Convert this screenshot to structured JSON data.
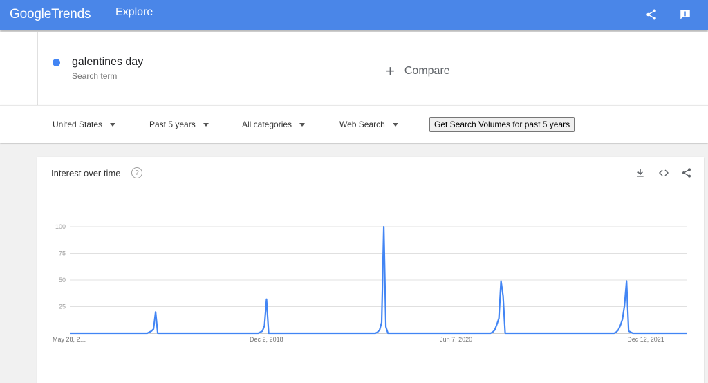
{
  "header": {
    "logo_google": "Google",
    "logo_trends": "Trends",
    "section": "Explore",
    "bg_color": "#4a86e8",
    "icons": [
      "share-icon",
      "feedback-icon"
    ]
  },
  "search": {
    "term": "galentines day",
    "term_type": "Search term",
    "term_color": "#4285f4",
    "compare_label": "Compare"
  },
  "filters": {
    "region": "United States",
    "time_range": "Past 5 years",
    "category": "All categories",
    "search_type": "Web Search",
    "volumes_button": "Get Search Volumes for past 5 years"
  },
  "card": {
    "title": "Interest over time",
    "help_glyph": "?",
    "icons": [
      "download-icon",
      "embed-icon",
      "share-icon"
    ]
  },
  "chart_data": {
    "type": "line",
    "title": "",
    "xlabel": "",
    "ylabel": "",
    "ylim": [
      0,
      100
    ],
    "yticks": [
      25,
      50,
      75,
      100
    ],
    "grid": true,
    "line_color": "#4285f4",
    "x_tick_labels": [
      "May 28, 2…",
      "Dec 2, 2018",
      "Jun 7, 2020",
      "Dec 12, 2021"
    ],
    "series": [
      {
        "values": [
          0,
          0,
          0,
          0,
          0,
          0,
          0,
          0,
          0,
          0,
          0,
          0,
          0,
          0,
          0,
          0,
          0,
          0,
          0,
          0,
          0,
          0,
          0,
          0,
          0,
          0,
          0,
          0,
          0,
          0,
          0,
          0,
          0,
          0,
          0,
          0,
          0,
          0,
          1,
          2,
          4,
          20,
          0,
          0,
          0,
          0,
          0,
          0,
          0,
          0,
          0,
          0,
          0,
          0,
          0,
          0,
          0,
          0,
          0,
          0,
          0,
          0,
          0,
          0,
          0,
          0,
          0,
          0,
          0,
          0,
          0,
          0,
          0,
          0,
          0,
          0,
          0,
          0,
          0,
          0,
          0,
          0,
          0,
          0,
          0,
          0,
          0,
          0,
          0,
          0,
          0,
          1,
          2,
          7,
          32,
          0,
          0,
          0,
          0,
          0,
          0,
          0,
          0,
          0,
          0,
          0,
          0,
          0,
          0,
          0,
          0,
          0,
          0,
          0,
          0,
          0,
          0,
          0,
          0,
          0,
          0,
          0,
          0,
          0,
          0,
          0,
          0,
          0,
          0,
          0,
          0,
          0,
          0,
          0,
          0,
          0,
          0,
          0,
          0,
          0,
          0,
          0,
          0,
          0,
          0,
          0,
          0,
          1,
          3,
          10,
          100,
          6,
          0,
          0,
          0,
          0,
          0,
          0,
          0,
          0,
          0,
          0,
          0,
          0,
          0,
          0,
          0,
          0,
          0,
          0,
          0,
          0,
          0,
          0,
          0,
          0,
          0,
          0,
          0,
          0,
          0,
          0,
          0,
          0,
          0,
          0,
          0,
          0,
          0,
          0,
          0,
          0,
          0,
          0,
          0,
          0,
          0,
          0,
          0,
          0,
          0,
          0,
          1,
          3,
          8,
          14,
          49,
          35,
          0,
          0,
          0,
          0,
          0,
          0,
          0,
          0,
          0,
          0,
          0,
          0,
          0,
          0,
          0,
          0,
          0,
          0,
          0,
          0,
          0,
          0,
          0,
          0,
          0,
          0,
          0,
          0,
          0,
          0,
          0,
          0,
          0,
          0,
          0,
          0,
          0,
          0,
          0,
          0,
          0,
          0,
          0,
          0,
          0,
          0,
          0,
          0,
          0,
          0,
          0,
          0,
          0,
          1,
          3,
          7,
          13,
          26,
          49,
          2,
          1,
          0,
          0,
          0,
          0,
          0,
          0,
          0,
          0,
          0,
          0,
          0,
          0,
          0,
          0,
          0,
          0,
          0,
          0,
          0,
          0,
          0,
          0,
          0,
          0,
          0,
          0,
          0
        ]
      }
    ]
  }
}
